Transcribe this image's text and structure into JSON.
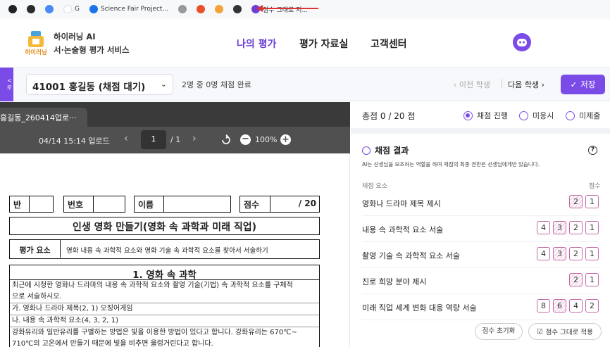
{
  "bookmarks": [
    {
      "label": "",
      "color": "#222222"
    },
    {
      "label": "",
      "color": "#2b2b2b"
    },
    {
      "label": "",
      "color": "#4a8af4"
    },
    {
      "label": "G",
      "color": "#ffffff"
    },
    {
      "label": "Science Fair Project...",
      "color": "#1a73e8"
    },
    {
      "label": "",
      "color": "#999999"
    },
    {
      "label": "",
      "color": "#e8502a"
    },
    {
      "label": "",
      "color": "#f2a23a"
    },
    {
      "label": "",
      "color": "#333333"
    },
    {
      "label": "점수 그대로 저...",
      "color": "#6b3fd6"
    }
  ],
  "header": {
    "logo_text": "하이러닝",
    "title": "하이러닝 AI",
    "subtitle": "서·논술형 평가 서비스",
    "nav": [
      "나의 평가",
      "평가 자료실",
      "고객센터"
    ]
  },
  "toolbar": {
    "left_tab": [
      "<",
      "로"
    ],
    "student": "41001 홍길동 (채점 대기)",
    "status": "2명 중 0명 채점 완료",
    "prev": "이전 학생",
    "next": "다음 학생",
    "save": "저장"
  },
  "doc": {
    "tab_name": "홍길동_260414업로···",
    "upload_time": "04/14 15:14 업로드",
    "page": "1",
    "page_total": "/ 1",
    "zoom": "100%"
  },
  "paper": {
    "class_label": "반",
    "number_label": "번호",
    "name_label": "이름",
    "score_label": "점수",
    "score_total": "/ 20",
    "title": "인생 영화 만들기(영화 속 과학과 미래 직업)",
    "goal_label": "평가 요소",
    "goal_text": "영화 내용 속 과학적 요소와 영화 기술 속 과학적 요소를 찾아서 서술하기",
    "section_title": "1. 영화 속 과학",
    "lines": [
      "최근에 시청한 영화나 드라마의 내용 속 과학적 요소와 촬영 기술(기법) 속 과학적 요소를 구체적",
      "으로 서술하시오.",
      "가. 영화나 드라마 제목(2, 1) 오징어게임",
      "나. 내용 속 과학적 요소(4, 3, 2, 1)",
      "강화유리와 일반유리를 구별하는 방법은 빛을 이용한 방법이 있다고 합니다. 강화유리는 670℃~",
      "710℃의 고온에서 만들기 때문에 빛을 비추면 울렁거린다고 합니다."
    ]
  },
  "grading": {
    "total": "총점 0 / 20 점",
    "modes": [
      {
        "label": "채점 진행",
        "selected": true
      },
      {
        "label": "미응시",
        "selected": false
      },
      {
        "label": "미제출",
        "selected": false
      }
    ],
    "result_title": "채점 결과",
    "notice": "AI는 선생님을 보조하는 역할을 하며 채점의 최종 권한은 선생님에게만 있습니다.",
    "col_criteria": "채점 요소",
    "col_score": "점수",
    "criteria": [
      {
        "label": "영화나 드라마 제목 제시",
        "scores": [
          "2",
          "1"
        ],
        "selected": "2"
      },
      {
        "label": "내용 속 과학적 요소 서술",
        "scores": [
          "4",
          "3",
          "2",
          "1"
        ],
        "selected": "3"
      },
      {
        "label": "촬영 기술 속 과학적 요소 서술",
        "scores": [
          "4",
          "3",
          "2",
          "1"
        ],
        "selected": "3"
      },
      {
        "label": "진로 희망 분야 제시",
        "scores": [
          "2",
          "1"
        ],
        "selected": "2"
      },
      {
        "label": "미래 직업 세계 변화 대응 역량 서술",
        "scores": [
          "8",
          "6",
          "4",
          "2"
        ],
        "selected": "6"
      }
    ],
    "reset": "점수 초기화",
    "apply": "점수 그대로 적용"
  },
  "colors": {
    "accent": "#7b4be8",
    "score_border": "#c46ba6",
    "arrow": "#dd3333"
  }
}
